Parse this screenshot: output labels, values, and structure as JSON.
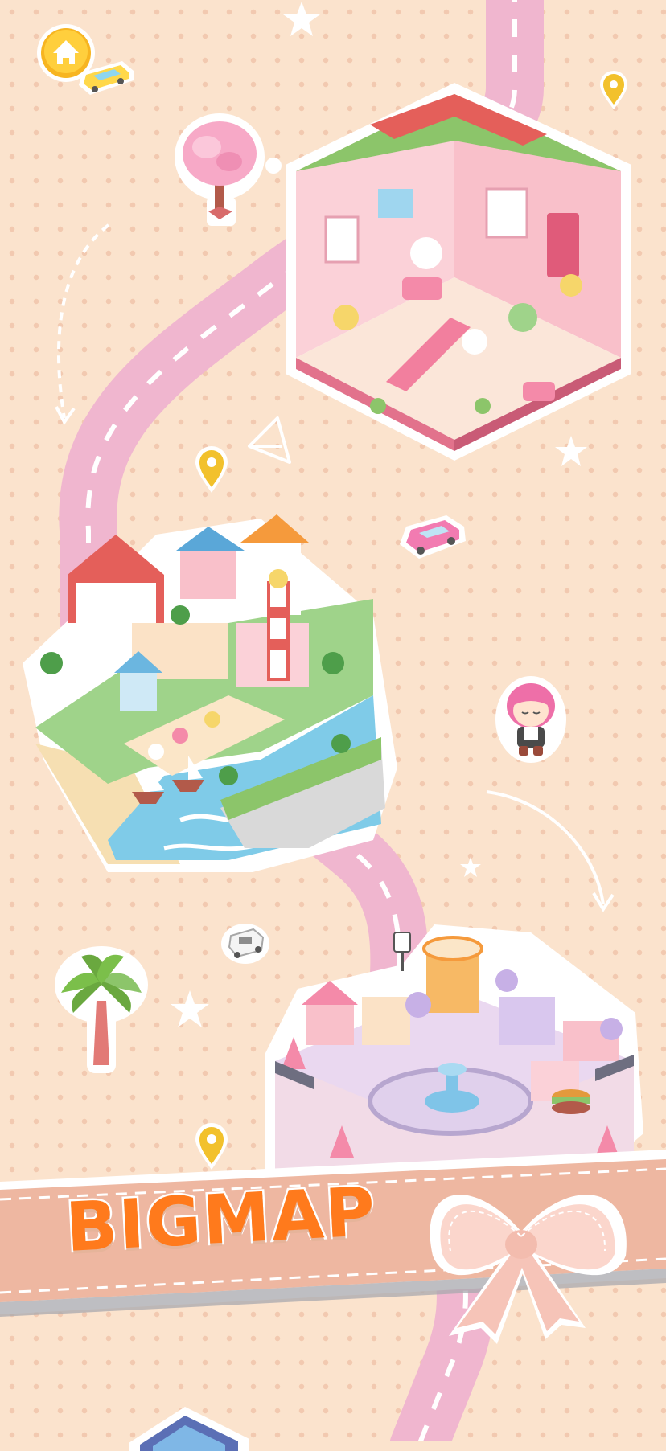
{
  "banner": {
    "title": "BIGMAP"
  },
  "nav": {
    "home_icon": "home-icon"
  },
  "areas": [
    {
      "id": "pink-house",
      "icon": "pink-house-island"
    },
    {
      "id": "beach-resort",
      "icon": "beach-resort-island"
    },
    {
      "id": "city-plaza",
      "icon": "city-plaza-island"
    }
  ],
  "decorations": [
    "blossom-tree",
    "palm-tree",
    "pink-car",
    "yellow-car",
    "white-van",
    "pink-haired-character",
    "location-pin",
    "ribbon-bow"
  ],
  "colors": {
    "background": "#fbe3cd",
    "road": "#f0b6cf",
    "banner": "#eeb7a1",
    "title": "#ff7a1c",
    "pin": "#f2c12c",
    "home_button": "#f7b521"
  }
}
